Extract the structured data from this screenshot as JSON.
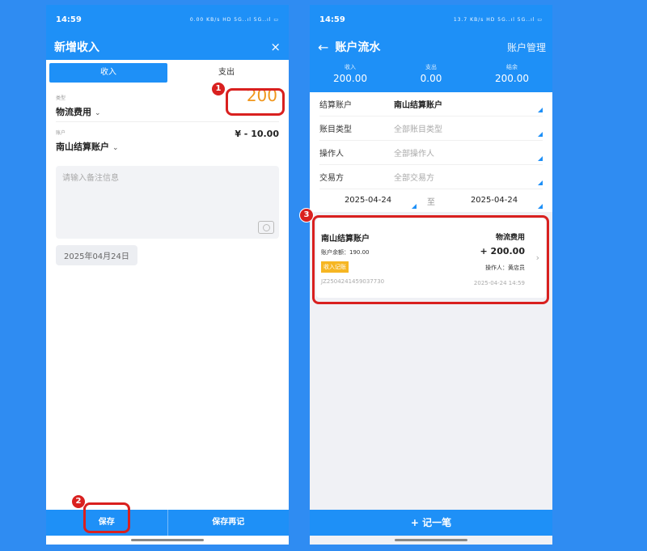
{
  "left": {
    "status": {
      "time": "14:59",
      "icons": "0.00 KB/s HD 5G..ıl 5G..ıl ▭"
    },
    "title": "新增收入",
    "close_icon": "×",
    "tabs": [
      {
        "label": "收入",
        "active": true
      },
      {
        "label": "支出",
        "active": false
      }
    ],
    "type_label": "类型",
    "type_value": "物流费用",
    "amount": "200",
    "account_label": "账户",
    "account_value": "南山结算账户",
    "account_amount": "¥ - 10.00",
    "note_placeholder": "请输入备注信息",
    "date": "2025年04月24日",
    "buttons": {
      "save": "保存",
      "save_again": "保存再记"
    }
  },
  "right": {
    "status": {
      "time": "14:59",
      "icons": "13.7 KB/s HD 5G..ıl 5G..ıl ▭"
    },
    "title": "账户流水",
    "manage": "账户管理",
    "summary": [
      {
        "label": "收入",
        "value": "200.00"
      },
      {
        "label": "支出",
        "value": "0.00"
      },
      {
        "label": "结余",
        "value": "200.00"
      }
    ],
    "filters": [
      {
        "key": "结算账户",
        "value": "南山结算账户",
        "set": true
      },
      {
        "key": "账目类型",
        "value": "全部账目类型",
        "set": false
      },
      {
        "key": "操作人",
        "value": "全部操作人",
        "set": false
      },
      {
        "key": "交易方",
        "value": "全部交易方",
        "set": false
      }
    ],
    "date_from": "2025-04-24",
    "date_sep": "至",
    "date_to": "2025-04-24",
    "record": {
      "account": "南山结算账户",
      "category": "物流费用",
      "balance": "账户余额：190.00",
      "amount": "+ 200.00",
      "tag": "收入记账",
      "operator": "操作人：黄店员",
      "id": "JZ2504241459037730",
      "time": "2025-04-24 14:59"
    },
    "add_button": "+ 记一笔"
  },
  "badges": [
    "1",
    "2",
    "3"
  ],
  "colors": {
    "primary": "#1e90f7",
    "accent": "#f0961c",
    "annotation": "#d9201f",
    "tag": "#f6b623"
  }
}
